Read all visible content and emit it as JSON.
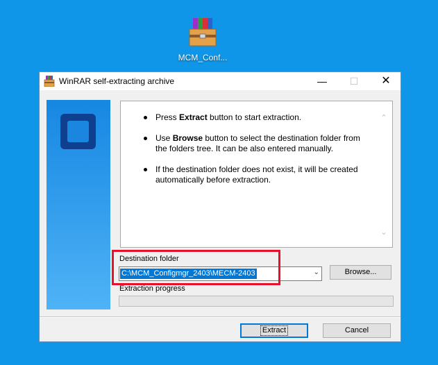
{
  "desktop": {
    "icon_label": "MCM_Conf...",
    "icon": "winrar-archive-icon",
    "background_color": "#1096e8"
  },
  "window": {
    "title": "WinRAR self-extracting archive",
    "controls": {
      "minimize": "—",
      "maximize": "☐",
      "close": "✕"
    }
  },
  "info": {
    "items": [
      {
        "pre": "Press ",
        "bold": "Extract",
        "post": " button to start extraction."
      },
      {
        "pre": "Use ",
        "bold": "Browse",
        "post": " button to select the destination folder from the folders tree. It can be also entered manually."
      },
      {
        "pre": "",
        "bold": "",
        "post": "If the destination folder does not exist, it will be created automatically before extraction."
      }
    ]
  },
  "destination": {
    "label": "Destination folder",
    "value": "C:\\MCM_Configmgr_2403\\MECM-2403",
    "browse_label": "Browse..."
  },
  "progress": {
    "label": "Extraction progress",
    "value": 0
  },
  "buttons": {
    "extract": "Extract",
    "cancel": "Cancel"
  },
  "colors": {
    "accent": "#0078d7",
    "highlight": "#e8112d",
    "side_panel": "#1687e2"
  }
}
